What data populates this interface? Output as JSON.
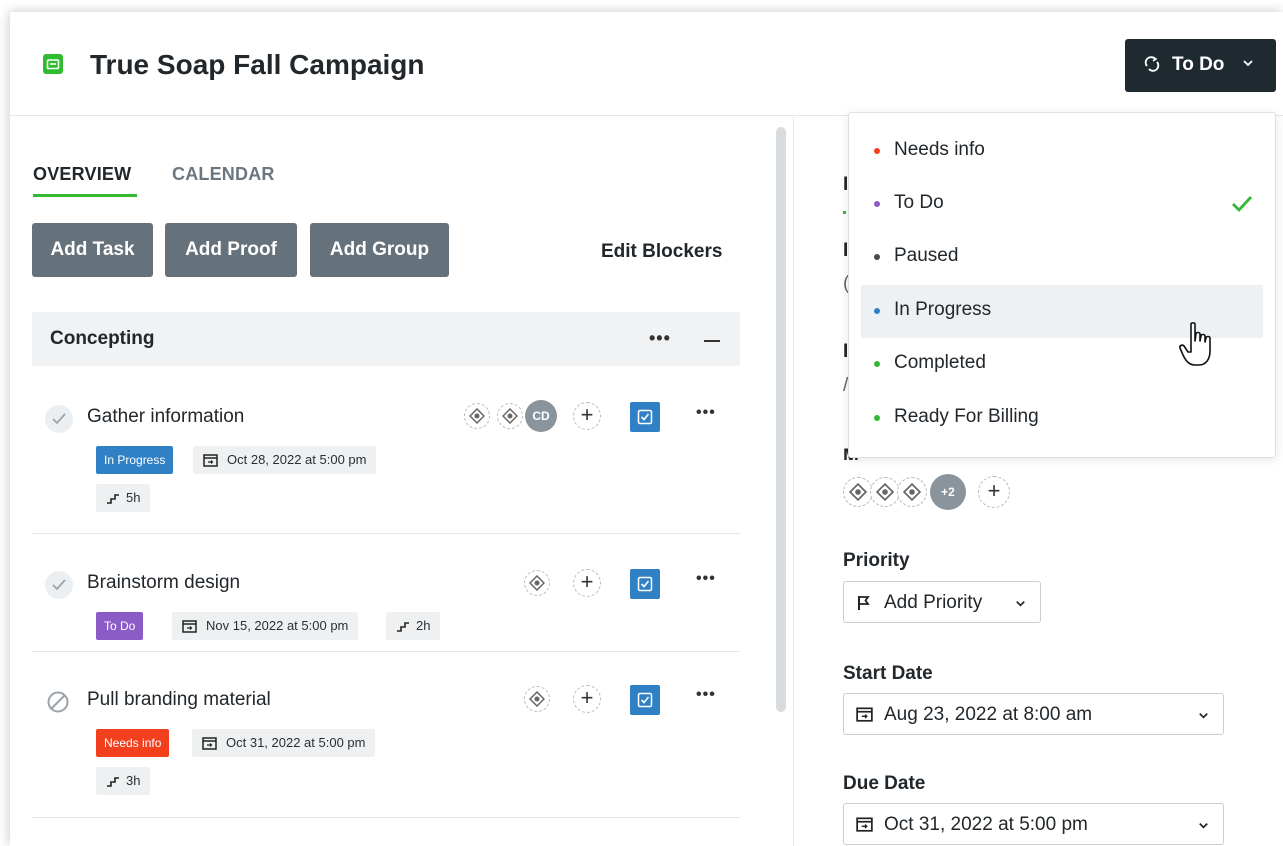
{
  "header": {
    "project_title": "True Soap Fall Campaign",
    "project_icon": "folder-icon",
    "status_button_label": "To Do",
    "colors": {
      "project_icon": "#2fbd2f",
      "status_button": "#1f2a30"
    }
  },
  "tabs": {
    "overview": "OVERVIEW",
    "calendar": "CALENDAR",
    "active": "OVERVIEW"
  },
  "toolbar": {
    "add_task": "Add Task",
    "add_proof": "Add Proof",
    "add_group": "Add Group",
    "edit_blockers": "Edit Blockers"
  },
  "group": {
    "name": "Concepting",
    "more": "•••"
  },
  "tasks": [
    {
      "name": "Gather information",
      "status": "In Progress",
      "due": "Oct 28, 2022 at 5:00 pm",
      "estimate": "5h",
      "assignee_initials": "CD"
    },
    {
      "name": "Brainstorm design",
      "status": "To Do",
      "due": "Nov 15, 2022 at 5:00 pm",
      "estimate": "2h"
    },
    {
      "name": "Pull branding material",
      "status": "Needs info",
      "due": "Oct 31, 2022 at 5:00 pm",
      "estimate": "3h"
    }
  ],
  "task_more": "•••",
  "right": {
    "members_more": "+2",
    "priority_label": "Priority",
    "priority_value": "Add Priority",
    "start_label": "Start Date",
    "start_value": "Aug 23, 2022 at 8:00 am",
    "due_label": "Due Date",
    "due_value": "Oct 31, 2022 at 5:00 pm"
  },
  "status_dropdown": {
    "selected": "To Do",
    "hovered": "In Progress",
    "options": [
      {
        "label": "Needs info",
        "color": "#f2401f"
      },
      {
        "label": "To Do",
        "color": "#8b5cc6"
      },
      {
        "label": "Paused",
        "color": "#444c52"
      },
      {
        "label": "In Progress",
        "color": "#2f80c5"
      },
      {
        "label": "Completed",
        "color": "#35b935"
      },
      {
        "label": "Ready For Billing",
        "color": "#35b935"
      }
    ]
  },
  "colors": {
    "status_in_progress": "#2f80c5",
    "status_to_do": "#8b5cc6",
    "status_needs_info": "#f2401f",
    "accent_green": "#35b935",
    "button_gray": "#66727b"
  }
}
